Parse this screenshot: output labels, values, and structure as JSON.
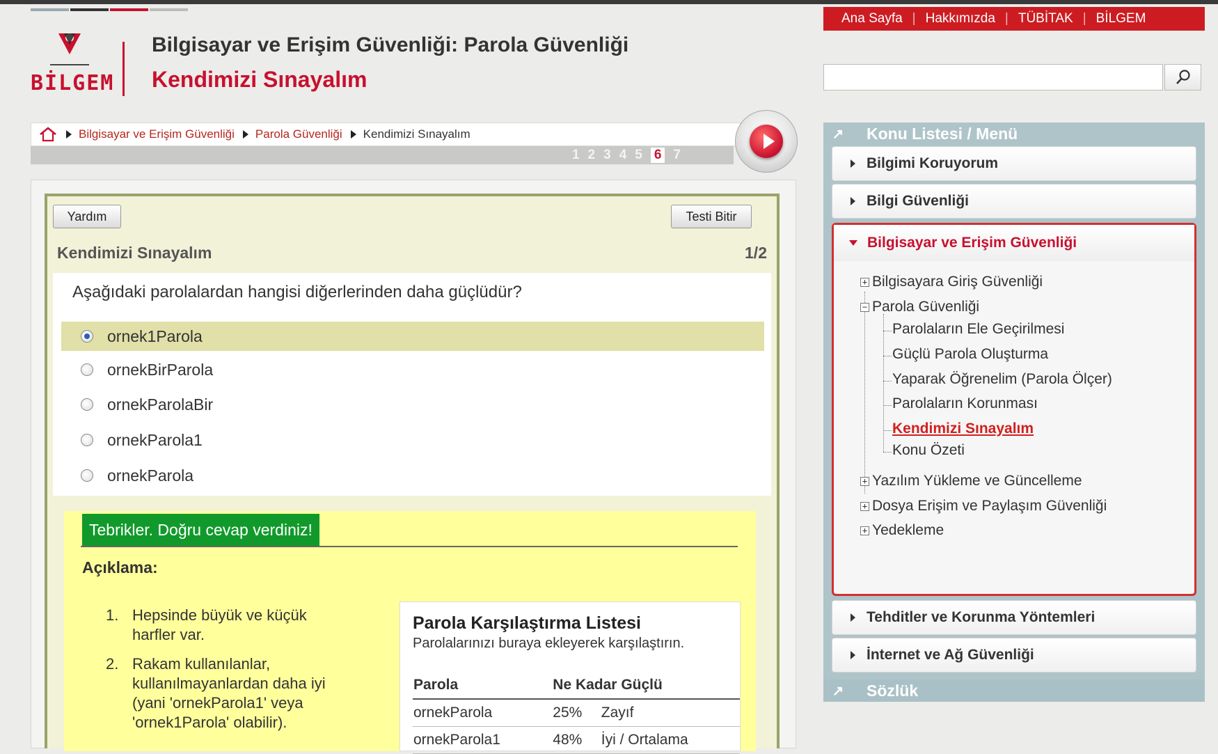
{
  "header": {
    "logo_text": "BİLGEM",
    "logo_small": "TÜBİTAK",
    "title": "Bilgisayar ve Erişim Güvenliği: Parola Güvenliği",
    "subtitle": "Kendimizi Sınayalım"
  },
  "top_nav": [
    "Ana Sayfa",
    "Hakkımızda",
    "TÜBİTAK",
    "BİLGEM"
  ],
  "search": {
    "placeholder": ""
  },
  "breadcrumb": [
    "Bilgisayar ve Erişim Güvenliği",
    "Parola Güvenliği",
    "Kendimizi Sınayalım"
  ],
  "pager": {
    "pages": [
      "1",
      "2",
      "3",
      "4",
      "5",
      "6",
      "7"
    ],
    "active": "6"
  },
  "quiz": {
    "help_label": "Yardım",
    "finish_label": "Testi Bitir",
    "title": "Kendimizi Sınayalım",
    "progress": "1/2",
    "question": "Aşağıdaki parolalardan hangisi diğerlerinden daha güçlüdür?",
    "options": [
      "ornek1Parola",
      "ornekBirParola",
      "ornekParolaBir",
      "ornekParola1",
      "ornekParola"
    ],
    "selected_index": 0,
    "feedback": "Tebrikler. Doğru cevap verdiniz!",
    "explanation_label": "Açıklama:",
    "explanations": [
      "Hepsinde büyük ve küçük harfler var.",
      "Rakam kullanılanlar, kullanılmayanlardan daha iyi (yani 'ornekParola1' veya 'ornek1Parola' olabilir)."
    ]
  },
  "compare": {
    "title": "Parola Karşılaştırma Listesi",
    "subtitle": "Parolalarınızı buraya ekleyerek karşılaştırın.",
    "headers": [
      "Parola",
      "Ne Kadar Güçlü"
    ],
    "rows": [
      {
        "password": "ornekParola",
        "percent": "25%",
        "level": "Zayıf"
      },
      {
        "password": "ornekParola1",
        "percent": "48%",
        "level": "İyi / Ortalama"
      }
    ]
  },
  "sidebar": {
    "heading": "Konu Listesi / Menü",
    "items": [
      "Bilgimi Koruyorum",
      "Bilgi Güvenliği"
    ],
    "open_item": "Bilgisayar ve Erişim Güvenliği",
    "tree": {
      "n1": "Bilgisayara Giriş Güvenliği",
      "n2": "Parola Güvenliği",
      "children": [
        "Parolaların Ele Geçirilmesi",
        "Güçlü Parola Oluşturma",
        "Yaparak Öğrenelim (Parola Ölçer)",
        "Parolaların Korunması",
        "Kendimizi Sınayalım",
        "Konu Özeti"
      ],
      "n3": "Yazılım Yükleme ve Güncelleme",
      "n4": "Dosya Erişim ve Paylaşım Güvenliği",
      "n5": "Yedekleme"
    },
    "after_items": [
      "Tehditler ve Korunma Yöntemleri",
      "İnternet ve Ağ Güvenliği"
    ],
    "footer": "Sözlük"
  },
  "colors": {
    "brand_red": "#c8102e",
    "correct_green": "#119a2b",
    "sidebar": "#aec4c9"
  }
}
